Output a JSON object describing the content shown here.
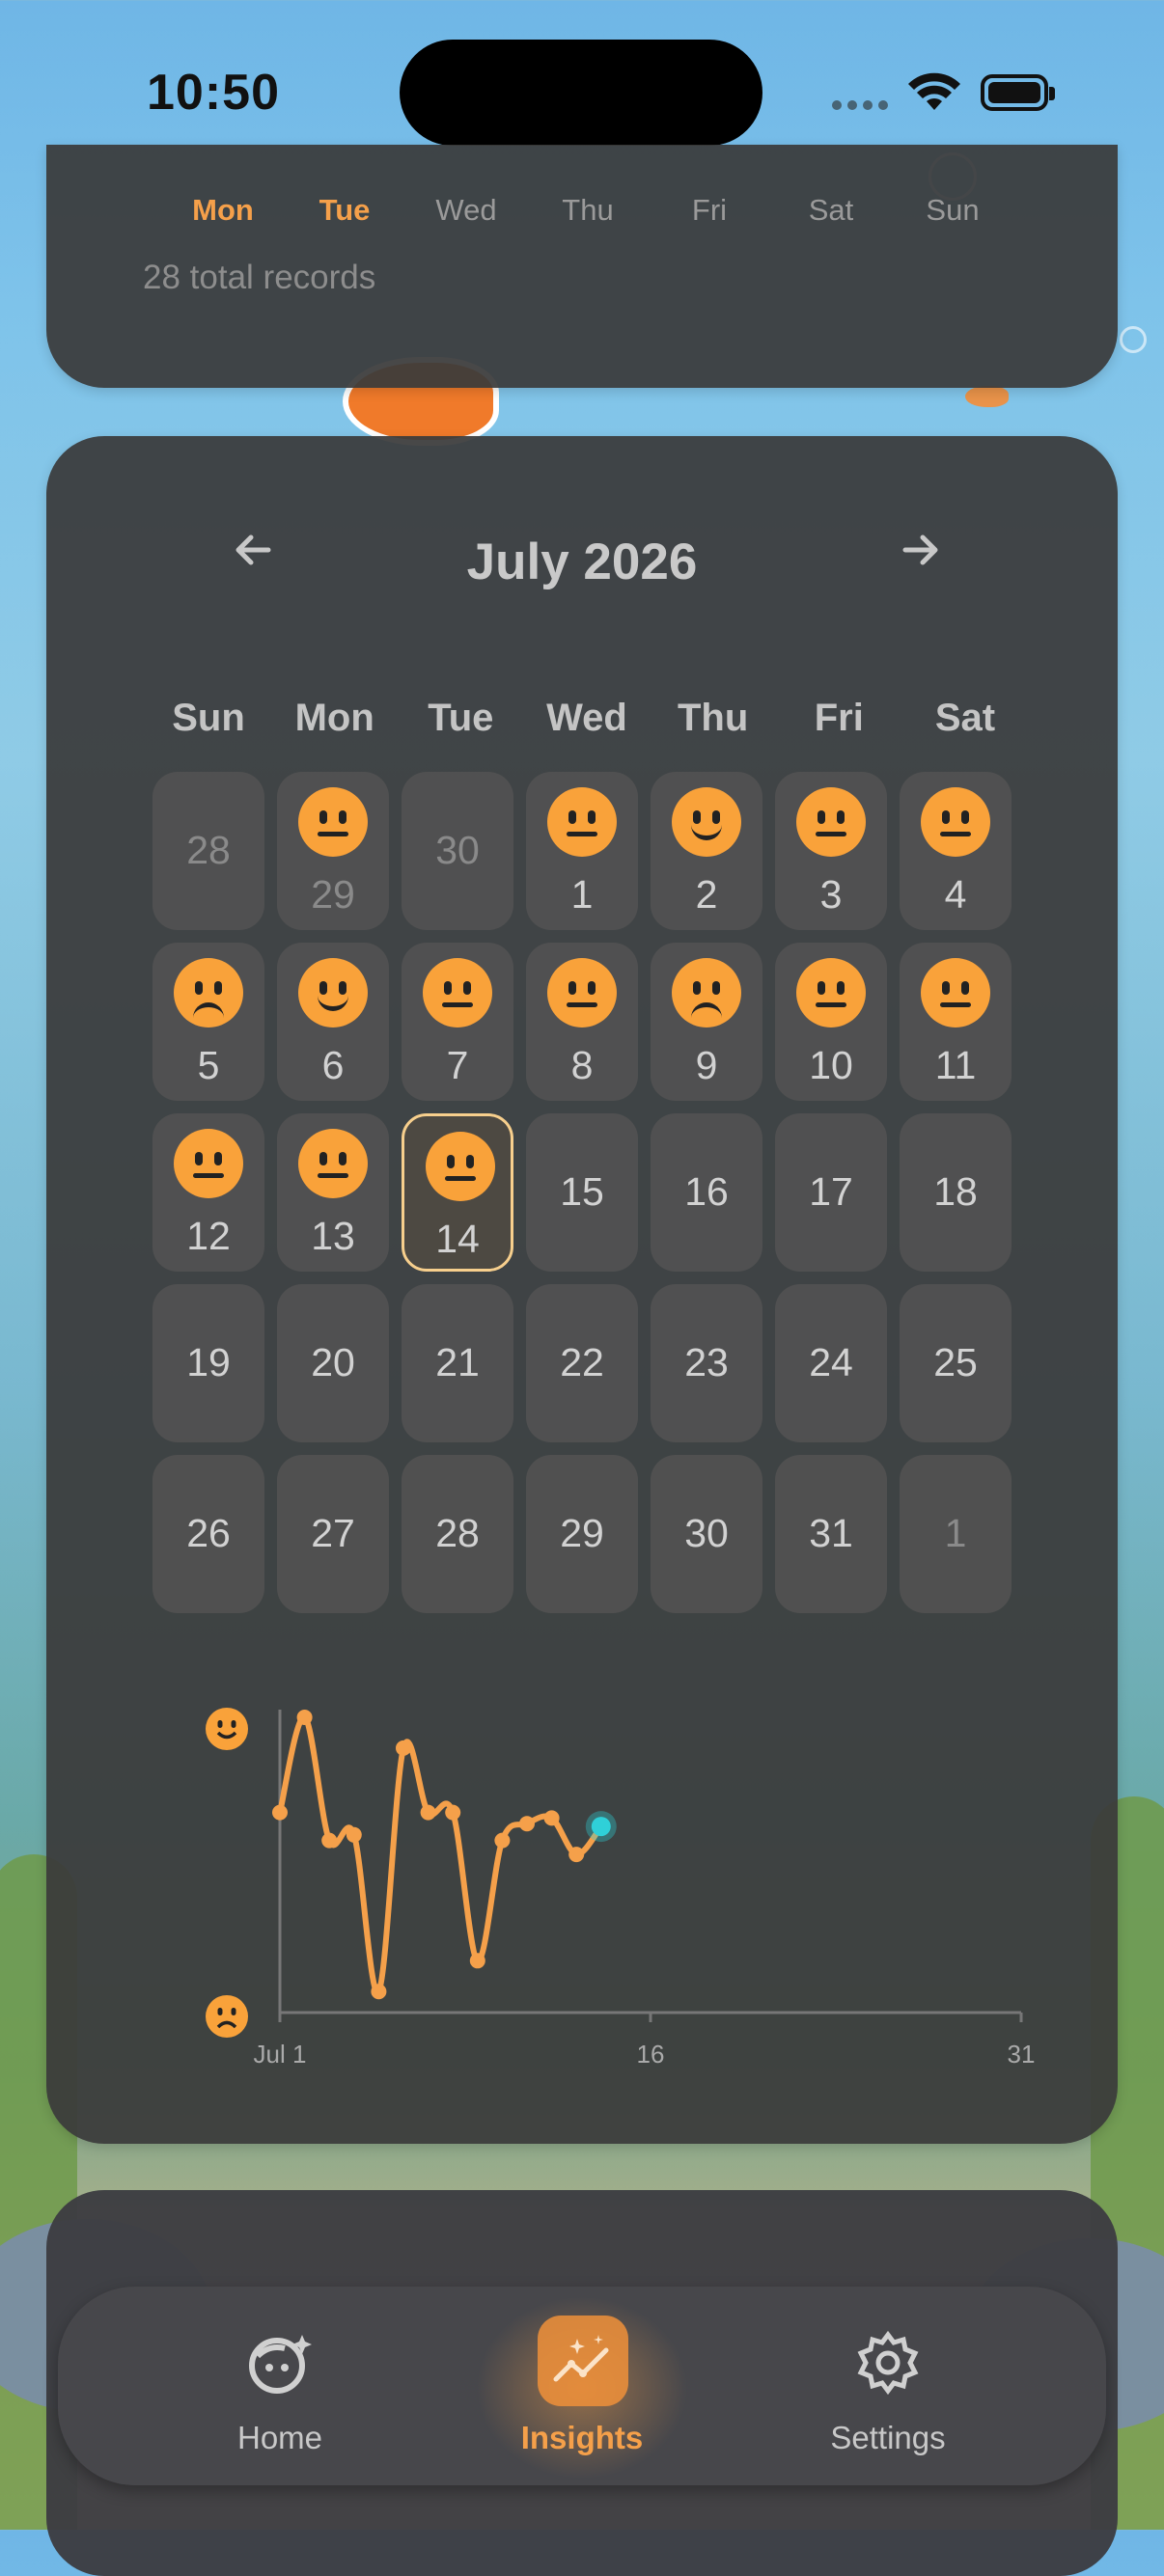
{
  "status_bar": {
    "time": "10:50"
  },
  "summary_card": {
    "weekdays": [
      "Mon",
      "Tue",
      "Wed",
      "Thu",
      "Fri",
      "Sat",
      "Sun"
    ],
    "highlighted_weekdays": [
      "Mon",
      "Tue"
    ],
    "total_records_text": "28 total records"
  },
  "calendar": {
    "month_title": "July 2026",
    "prev_icon": "arrow-left-icon",
    "next_icon": "arrow-right-icon",
    "day_headers": [
      "Sun",
      "Mon",
      "Tue",
      "Wed",
      "Thu",
      "Fri",
      "Sat"
    ],
    "days": [
      {
        "day": "28",
        "out": true,
        "mood": null
      },
      {
        "day": "29",
        "out": true,
        "mood": "neutral"
      },
      {
        "day": "30",
        "out": true,
        "mood": null
      },
      {
        "day": "1",
        "out": false,
        "mood": "neutral"
      },
      {
        "day": "2",
        "out": false,
        "mood": "happy"
      },
      {
        "day": "3",
        "out": false,
        "mood": "neutral"
      },
      {
        "day": "4",
        "out": false,
        "mood": "neutral"
      },
      {
        "day": "5",
        "out": false,
        "mood": "sad"
      },
      {
        "day": "6",
        "out": false,
        "mood": "happy"
      },
      {
        "day": "7",
        "out": false,
        "mood": "neutral"
      },
      {
        "day": "8",
        "out": false,
        "mood": "neutral"
      },
      {
        "day": "9",
        "out": false,
        "mood": "sad"
      },
      {
        "day": "10",
        "out": false,
        "mood": "neutral"
      },
      {
        "day": "11",
        "out": false,
        "mood": "neutral"
      },
      {
        "day": "12",
        "out": false,
        "mood": "neutral"
      },
      {
        "day": "13",
        "out": false,
        "mood": "neutral"
      },
      {
        "day": "14",
        "out": false,
        "mood": "neutral",
        "selected": true
      },
      {
        "day": "15",
        "out": false,
        "mood": null
      },
      {
        "day": "16",
        "out": false,
        "mood": null
      },
      {
        "day": "17",
        "out": false,
        "mood": null
      },
      {
        "day": "18",
        "out": false,
        "mood": null
      },
      {
        "day": "19",
        "out": false,
        "mood": null
      },
      {
        "day": "20",
        "out": false,
        "mood": null
      },
      {
        "day": "21",
        "out": false,
        "mood": null
      },
      {
        "day": "22",
        "out": false,
        "mood": null
      },
      {
        "day": "23",
        "out": false,
        "mood": null
      },
      {
        "day": "24",
        "out": false,
        "mood": null
      },
      {
        "day": "25",
        "out": false,
        "mood": null
      },
      {
        "day": "26",
        "out": false,
        "mood": null
      },
      {
        "day": "27",
        "out": false,
        "mood": null
      },
      {
        "day": "28",
        "out": false,
        "mood": null
      },
      {
        "day": "29",
        "out": false,
        "mood": null
      },
      {
        "day": "30",
        "out": false,
        "mood": null
      },
      {
        "day": "31",
        "out": false,
        "mood": null
      },
      {
        "day": "1",
        "out": true,
        "mood": null
      }
    ]
  },
  "chart_data": {
    "type": "line",
    "x_tick_labels": [
      "Jul 1",
      "16",
      "31"
    ],
    "x_range": [
      1,
      31
    ],
    "y_range": [
      0,
      1
    ],
    "y_axis_icons": [
      "happy-face-icon",
      "sad-face-icon"
    ],
    "series": [
      {
        "x": [
          1,
          2,
          3,
          4,
          5,
          6,
          7,
          8,
          9,
          10,
          11,
          12,
          13,
          14
        ],
        "y": [
          0.66,
          1.0,
          0.56,
          0.58,
          0.02,
          0.89,
          0.66,
          0.66,
          0.13,
          0.56,
          0.62,
          0.64,
          0.51,
          0.61
        ],
        "color": "#f5a04a",
        "last_point_color": "#2fd0d8"
      }
    ]
  },
  "tab_bar": {
    "tabs": [
      {
        "label": "Home",
        "icon": "smiley-sparkle-icon",
        "active": false
      },
      {
        "label": "Insights",
        "icon": "trend-chart-icon",
        "active": true
      },
      {
        "label": "Settings",
        "icon": "gear-icon",
        "active": false
      }
    ]
  },
  "colors": {
    "accent": "#f5a04a",
    "mood_face": "#f9a23a",
    "today_point": "#2fd0d8"
  }
}
